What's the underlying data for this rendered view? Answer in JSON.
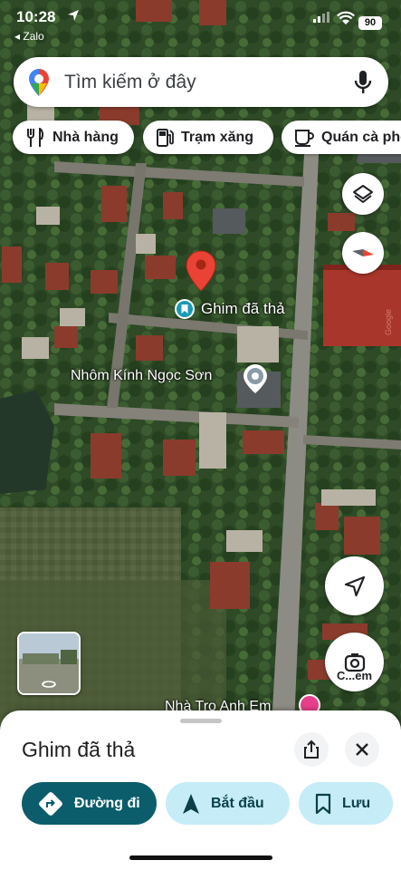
{
  "status_bar": {
    "time": "10:28",
    "back_app": "Zalo",
    "battery": "90"
  },
  "search": {
    "placeholder": "Tìm kiếm ở đây"
  },
  "chips": [
    {
      "label": "Nhà hàng",
      "icon": "fork-knife-icon"
    },
    {
      "label": "Trạm xăng",
      "icon": "gas-station-icon"
    },
    {
      "label": "Quán cà phê",
      "icon": "coffee-cup-icon"
    }
  ],
  "map": {
    "dropped_pin_label": "Ghim đã thả",
    "place_label": "Nhôm Kính Ngọc Sơn",
    "place_label_2": "Nhà Trọ Anh Em",
    "building_label": "Google",
    "lens_label": "C...em"
  },
  "sheet": {
    "title": "Ghim đã thả",
    "directions_label": "Đường đi",
    "start_label": "Bắt đầu",
    "save_label": "Lưu"
  },
  "colors": {
    "primary_teal": "#0b5d6b",
    "light_teal": "#c5ecf7",
    "pin_red": "#ea4335"
  }
}
